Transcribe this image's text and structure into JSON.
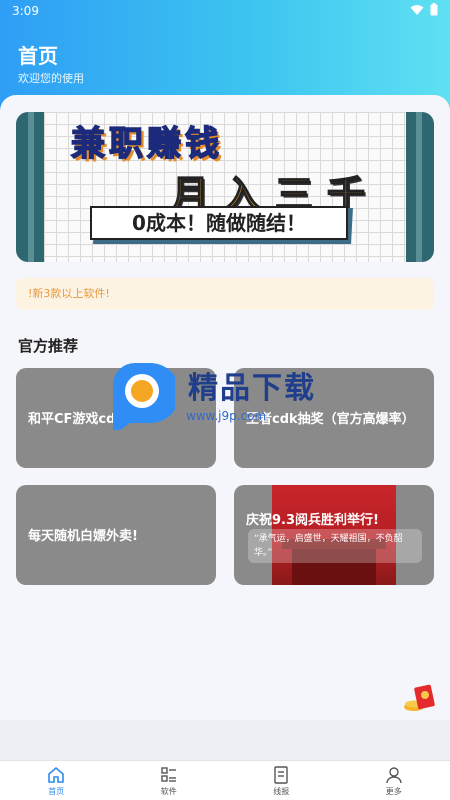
{
  "status_bar": {
    "time": "3:09"
  },
  "header": {
    "title": "首页",
    "subtitle": "欢迎您的使用"
  },
  "banner": {
    "line1": "兼职赚钱",
    "line2": "月入三千",
    "line3": "0成本！随做随结！",
    "active_dot": 3,
    "dot_count": 3
  },
  "notice": {
    "text": "!新3款以上软件!"
  },
  "section": {
    "title": "官方推荐"
  },
  "cards": [
    {
      "label": "和平CF游戏cdk"
    },
    {
      "label": "王者cdk抽奖（官方高爆率）"
    },
    {
      "label": "每天随机白嫖外卖!"
    },
    {
      "label": "庆祝9.3阅兵胜利举行!",
      "quote": "“承气运，启盛世，天耀祖国，不负韶华。”"
    }
  ],
  "watermark": {
    "title": "精品下载",
    "url": "www.j9p.com"
  },
  "tabbar": {
    "items": [
      {
        "label": "首页",
        "icon": "home-icon",
        "active": true
      },
      {
        "label": "软件",
        "icon": "list-icon",
        "active": false
      },
      {
        "label": "线报",
        "icon": "document-icon",
        "active": false
      },
      {
        "label": "更多",
        "icon": "user-icon",
        "active": false
      }
    ]
  },
  "colors": {
    "accent": "#2a8cf0",
    "hero_start": "#2f9ef5",
    "hero_end": "#5fe0f2",
    "notice_text": "#e89a3c"
  }
}
